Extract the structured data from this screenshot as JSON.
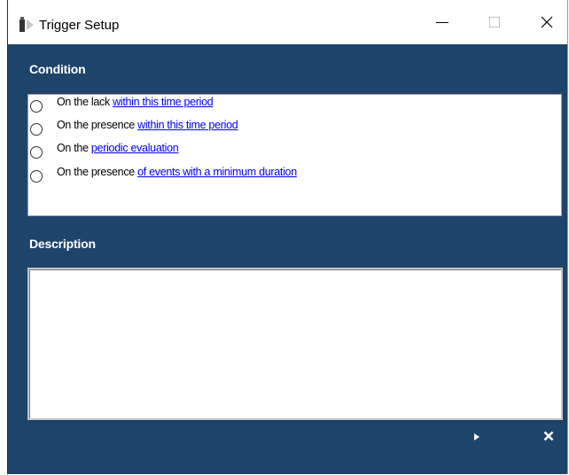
{
  "window": {
    "title": "Trigger Setup"
  },
  "condition": {
    "label": "Condition",
    "items": [
      {
        "prefix": "On the lack ",
        "link": "within this time period"
      },
      {
        "prefix": "On the presence ",
        "link": "within this time period"
      },
      {
        "prefix": "On the ",
        "link": "periodic evaluation"
      },
      {
        "prefix": "On the presence ",
        "link": "of events with a minimum duration"
      }
    ]
  },
  "description": {
    "label": "Description",
    "value": ""
  },
  "colors": {
    "panel_background": "#1e446b",
    "link": "#0000ee",
    "label_text": "#ffffff"
  },
  "icons": {
    "app": "trigger-setup-icon",
    "minimize": "minimize-icon",
    "maximize": "maximize-icon",
    "close": "close-icon",
    "next": "play-triangle-icon",
    "cancel": "x-icon"
  }
}
